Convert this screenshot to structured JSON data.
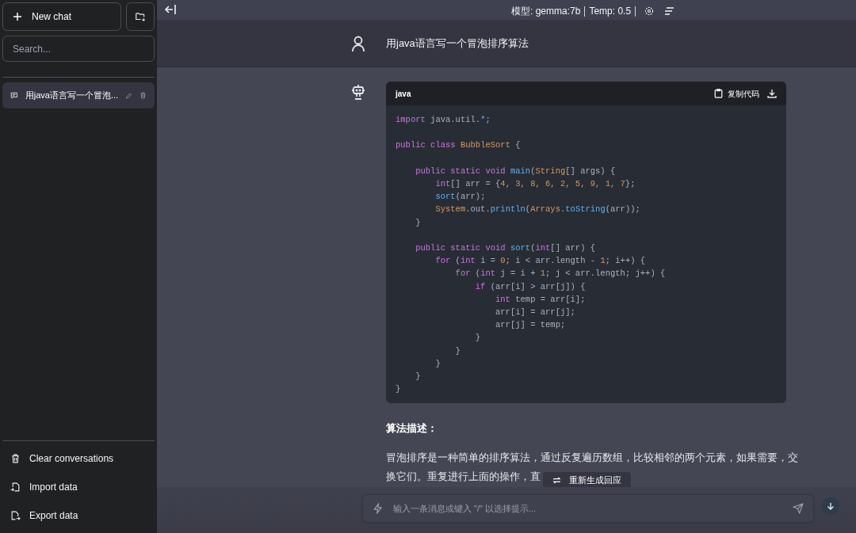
{
  "sidebar": {
    "new_chat": "New chat",
    "search": {
      "placeholder": "Search..."
    },
    "conversations": [
      {
        "title": "用java语言写一个冒泡...",
        "selected": true
      }
    ],
    "footer_items": [
      {
        "label": "Clear conversations",
        "kind": "clear"
      },
      {
        "label": "Import data",
        "kind": "import"
      },
      {
        "label": "Export data",
        "kind": "export"
      }
    ]
  },
  "header": {
    "model": "模型: gemma:7b",
    "temp": "Temp: 0.5"
  },
  "messages": [
    {
      "kind": "user",
      "text": "用java语言写一个冒泡排序算法"
    },
    {
      "kind": "assistant",
      "code": {
        "language": "java",
        "copy_label": "复制代码",
        "tokens": [
          {
            "text": "import",
            "kind": "keyword"
          },
          {
            "text": " java.util.",
            "kind": "plain"
          },
          {
            "text": "*",
            "kind": "operator"
          },
          {
            "text": ";",
            "kind": "plain"
          },
          {
            "text": "\n\npublic class",
            "kind": "keyword"
          },
          {
            "text": " BubbleSort",
            "kind": "type"
          },
          {
            "text": " {",
            "kind": "plain"
          },
          {
            "text": "\n\n    public static void",
            "kind": "keyword"
          },
          {
            "text": " main",
            "kind": "function"
          },
          {
            "text": "(",
            "kind": "plain"
          },
          {
            "text": "String",
            "kind": "type"
          },
          {
            "text": "[] args) {",
            "kind": "plain"
          },
          {
            "text": "\n        int",
            "kind": "keyword"
          },
          {
            "text": "[] arr = {",
            "kind": "plain"
          },
          {
            "text": "4, 3, 8, 6, 2, 5, 9, 1, 7",
            "kind": "number"
          },
          {
            "text": "};",
            "kind": "plain"
          },
          {
            "text": "\n        sort",
            "kind": "function"
          },
          {
            "text": "(arr);",
            "kind": "plain"
          },
          {
            "text": "\n        System",
            "kind": "type"
          },
          {
            "text": ".out.",
            "kind": "plain"
          },
          {
            "text": "println",
            "kind": "function"
          },
          {
            "text": "(",
            "kind": "plain"
          },
          {
            "text": "Arrays",
            "kind": "type"
          },
          {
            "text": ".",
            "kind": "plain"
          },
          {
            "text": "toString",
            "kind": "function"
          },
          {
            "text": "(arr));\n    }",
            "kind": "plain"
          },
          {
            "text": "\n\n    public static void",
            "kind": "keyword"
          },
          {
            "text": " sort",
            "kind": "function"
          },
          {
            "text": "(",
            "kind": "plain"
          },
          {
            "text": "int",
            "kind": "keyword"
          },
          {
            "text": "[] arr) {",
            "kind": "plain"
          },
          {
            "text": "\n        for",
            "kind": "keyword"
          },
          {
            "text": " (",
            "kind": "plain"
          },
          {
            "text": "int",
            "kind": "keyword"
          },
          {
            "text": " i = ",
            "kind": "plain"
          },
          {
            "text": "0",
            "kind": "number"
          },
          {
            "text": "; i < arr.length - ",
            "kind": "plain"
          },
          {
            "text": "1",
            "kind": "number"
          },
          {
            "text": "; i++) {",
            "kind": "plain"
          },
          {
            "text": "\n            for",
            "kind": "keyword"
          },
          {
            "text": " (",
            "kind": "plain"
          },
          {
            "text": "int",
            "kind": "keyword"
          },
          {
            "text": " j = i + ",
            "kind": "plain"
          },
          {
            "text": "1",
            "kind": "number"
          },
          {
            "text": "; j < arr.length; j++) {",
            "kind": "plain"
          },
          {
            "text": "\n                if",
            "kind": "keyword"
          },
          {
            "text": " (arr[i] > arr[j]) {",
            "kind": "plain"
          },
          {
            "text": "\n                    int",
            "kind": "keyword"
          },
          {
            "text": " temp = arr[i];\n                    arr[i] = arr[j];\n                    arr[j] = temp;\n                }\n            }\n        }\n    }\n}",
            "kind": "plain"
          }
        ]
      },
      "heading": "算法描述：",
      "paragraph_lines": [
        "冒泡排序是一种简单的排序算法，通过反复遍历数组，比较相邻的两个元素，如果需要，交",
        "换它们。重复进行上面的操作，直"
      ]
    }
  ],
  "regenerate": "重新生成回应",
  "input": {
    "placeholder": "输入一条消息或键入 \"/\" 以选择提示..."
  }
}
